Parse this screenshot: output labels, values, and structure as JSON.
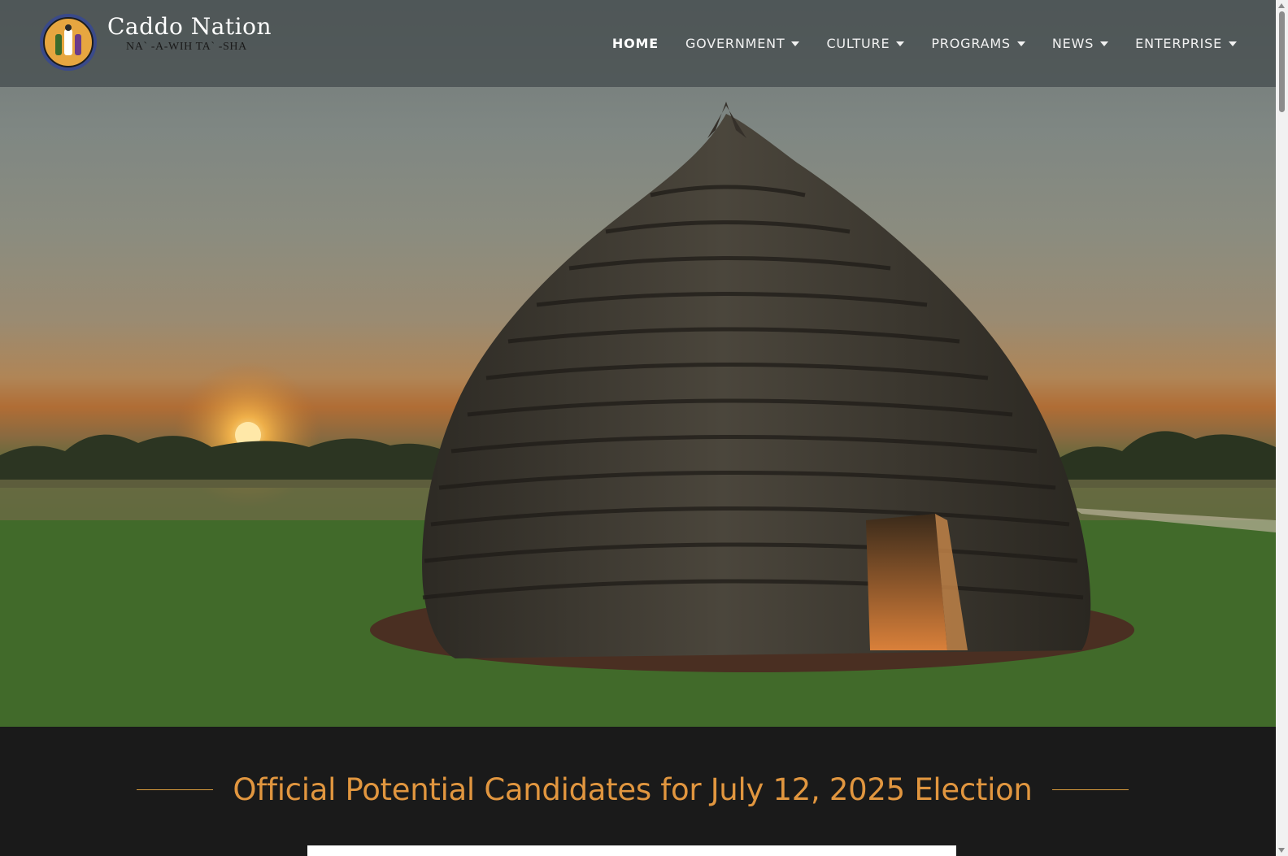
{
  "brand": {
    "title": "Caddo Nation",
    "subtitle": "NA` -A-WIH TA` -SHA",
    "logo_icon": "caddo-nation-seal-icon"
  },
  "nav": {
    "items": [
      {
        "label": "HOME",
        "active": true,
        "has_dropdown": false
      },
      {
        "label": "GOVERNMENT",
        "active": false,
        "has_dropdown": true
      },
      {
        "label": "CULTURE",
        "active": false,
        "has_dropdown": true
      },
      {
        "label": "PROGRAMS",
        "active": false,
        "has_dropdown": true
      },
      {
        "label": "NEWS",
        "active": false,
        "has_dropdown": true
      },
      {
        "label": "ENTERPRISE",
        "active": false,
        "has_dropdown": true
      }
    ]
  },
  "hero": {
    "image": "grass-house-at-sunset"
  },
  "announcement": {
    "title": "Official Potential Candidates for July 12, 2025 Election"
  },
  "colors": {
    "accent": "#e1963f",
    "header_bg": "#464e50",
    "section_bg": "#1a1a1a"
  }
}
